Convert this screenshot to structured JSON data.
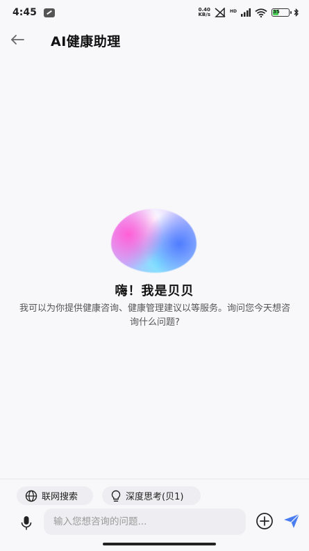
{
  "status_bar": {
    "time": "4:45",
    "net_speed_value": "0.40",
    "net_speed_unit": "KB/s",
    "hd_label": "HD",
    "battery_level": "35",
    "battery_percent": 35
  },
  "header": {
    "title": "AI健康助理"
  },
  "welcome": {
    "greeting": "嗨！我是贝贝",
    "intro": "我可以为你提供健康咨询、健康管理建议以等服务。询问您今天想咨询什么问题?"
  },
  "chips": {
    "web_search": "联网搜索",
    "deep_think": "深度思考(贝1)"
  },
  "composer": {
    "placeholder": "输入您想咨询的问题..."
  },
  "colors": {
    "accent": "#4a7df0",
    "background": "#f8f8fa",
    "chip_bg": "#eeeef2"
  }
}
